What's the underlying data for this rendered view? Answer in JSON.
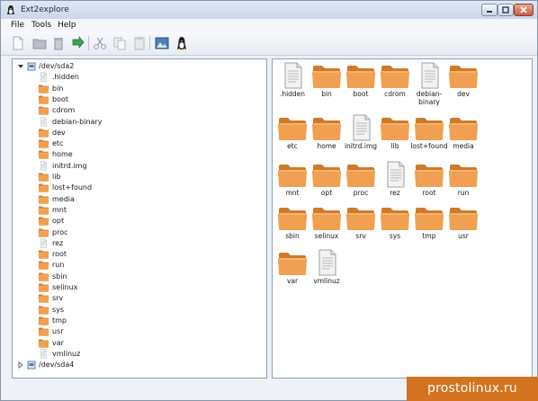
{
  "window": {
    "title": "Ext2explore"
  },
  "menu": [
    "File",
    "Tools",
    "Help"
  ],
  "toolbar": {
    "buttons": [
      {
        "name": "new-document-icon"
      },
      {
        "name": "open-folder-icon"
      },
      {
        "name": "trash-icon"
      },
      {
        "name": "green-arrow-icon"
      },
      {
        "name": "scissors-icon"
      },
      {
        "name": "copy-icon"
      },
      {
        "name": "paste-icon"
      },
      {
        "name": "image-icon"
      },
      {
        "name": "tux-penguin-icon"
      }
    ]
  },
  "tree": {
    "root": {
      "label": "/dev/sda2",
      "expanded": true
    },
    "children": [
      {
        "label": ".hidden",
        "type": "file"
      },
      {
        "label": "bin",
        "type": "folder"
      },
      {
        "label": "boot",
        "type": "folder"
      },
      {
        "label": "cdrom",
        "type": "folder"
      },
      {
        "label": "debian-binary",
        "type": "file"
      },
      {
        "label": "dev",
        "type": "folder"
      },
      {
        "label": "etc",
        "type": "folder"
      },
      {
        "label": "home",
        "type": "folder"
      },
      {
        "label": "initrd.img",
        "type": "file"
      },
      {
        "label": "lib",
        "type": "folder"
      },
      {
        "label": "lost+found",
        "type": "folder"
      },
      {
        "label": "media",
        "type": "folder"
      },
      {
        "label": "mnt",
        "type": "folder"
      },
      {
        "label": "opt",
        "type": "folder"
      },
      {
        "label": "proc",
        "type": "folder"
      },
      {
        "label": "rez",
        "type": "file"
      },
      {
        "label": "root",
        "type": "folder"
      },
      {
        "label": "run",
        "type": "folder"
      },
      {
        "label": "sbin",
        "type": "folder"
      },
      {
        "label": "selinux",
        "type": "folder"
      },
      {
        "label": "srv",
        "type": "folder"
      },
      {
        "label": "sys",
        "type": "folder"
      },
      {
        "label": "tmp",
        "type": "folder"
      },
      {
        "label": "usr",
        "type": "folder"
      },
      {
        "label": "var",
        "type": "folder"
      },
      {
        "label": "vmlinuz",
        "type": "file"
      }
    ],
    "second_root": {
      "label": "/dev/sda4",
      "expanded": false
    }
  },
  "grid": [
    {
      "label": ".hidden",
      "type": "file"
    },
    {
      "label": "bin",
      "type": "folder"
    },
    {
      "label": "boot",
      "type": "folder"
    },
    {
      "label": "cdrom",
      "type": "folder"
    },
    {
      "label": "debian-\nbinary",
      "type": "file"
    },
    {
      "label": "dev",
      "type": "folder"
    },
    {
      "label": "etc",
      "type": "folder"
    },
    {
      "label": "home",
      "type": "folder"
    },
    {
      "label": "initrd.img",
      "type": "file"
    },
    {
      "label": "lib",
      "type": "folder"
    },
    {
      "label": "lost+found",
      "type": "folder"
    },
    {
      "label": "media",
      "type": "folder"
    },
    {
      "label": "mnt",
      "type": "folder"
    },
    {
      "label": "opt",
      "type": "folder"
    },
    {
      "label": "proc",
      "type": "folder"
    },
    {
      "label": "rez",
      "type": "file"
    },
    {
      "label": "root",
      "type": "folder"
    },
    {
      "label": "run",
      "type": "folder"
    },
    {
      "label": "sbin",
      "type": "folder"
    },
    {
      "label": "selinux",
      "type": "folder"
    },
    {
      "label": "srv",
      "type": "folder"
    },
    {
      "label": "sys",
      "type": "folder"
    },
    {
      "label": "tmp",
      "type": "folder"
    },
    {
      "label": "usr",
      "type": "folder"
    },
    {
      "label": "var",
      "type": "folder"
    },
    {
      "label": "vmlinuz",
      "type": "file"
    }
  ],
  "watermark": "prostolinux.ru",
  "colors": {
    "folder": "#f0a050",
    "folder_dark": "#d07a28",
    "file": "#f2f2f2",
    "watermark": "#d4731f"
  }
}
